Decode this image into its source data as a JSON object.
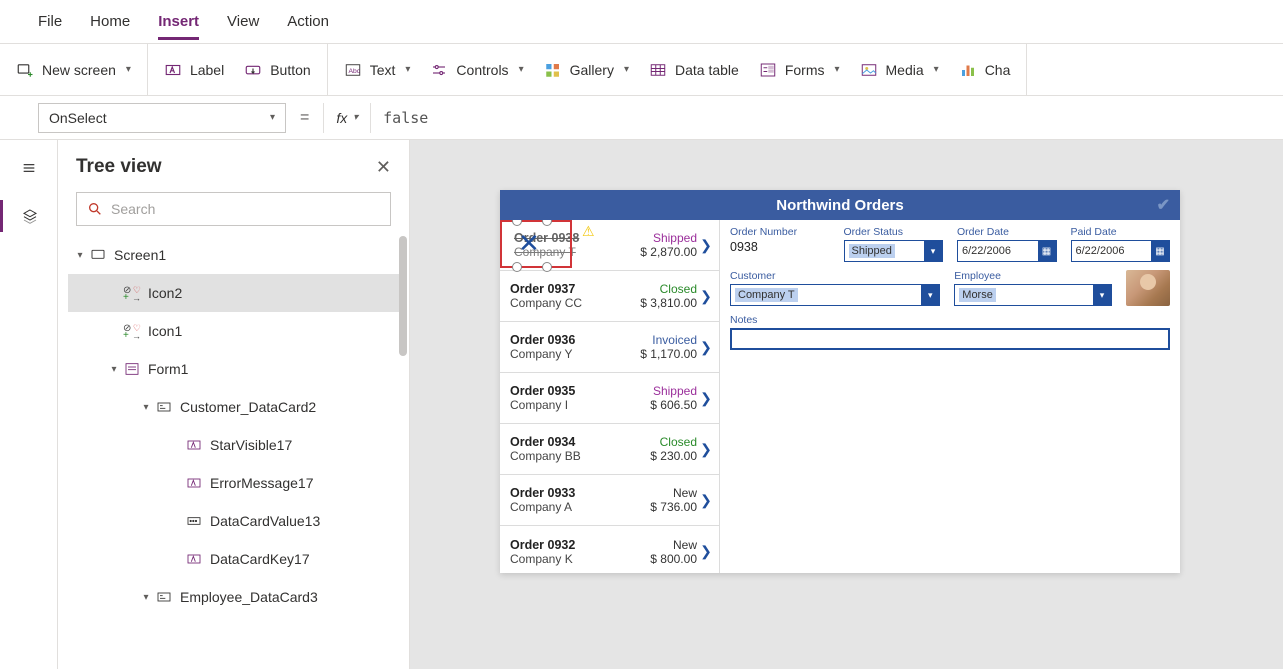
{
  "menubar": [
    "File",
    "Home",
    "Insert",
    "View",
    "Action"
  ],
  "menubar_active": 2,
  "ribbon": {
    "new_screen": "New screen",
    "label": "Label",
    "button": "Button",
    "text": "Text",
    "controls": "Controls",
    "gallery": "Gallery",
    "datatable": "Data table",
    "forms": "Forms",
    "media": "Media",
    "cha": "Cha"
  },
  "formula": {
    "property": "OnSelect",
    "equals": "=",
    "fx": "fx",
    "value": "false"
  },
  "treepanel": {
    "title": "Tree view",
    "search_placeholder": "Search",
    "items": [
      {
        "label": "Screen1",
        "type": "screen",
        "indent": 0,
        "expanded": true
      },
      {
        "label": "Icon2",
        "type": "icon-combo",
        "indent": 1,
        "selected": true
      },
      {
        "label": "Icon1",
        "type": "icon-combo",
        "indent": 1
      },
      {
        "label": "Form1",
        "type": "form",
        "indent": 1,
        "expanded": true
      },
      {
        "label": "Customer_DataCard2",
        "type": "card",
        "indent": 2,
        "expanded": true
      },
      {
        "label": "StarVisible17",
        "type": "label",
        "indent": 3
      },
      {
        "label": "ErrorMessage17",
        "type": "label",
        "indent": 3
      },
      {
        "label": "DataCardValue13",
        "type": "combo",
        "indent": 3
      },
      {
        "label": "DataCardKey17",
        "type": "label",
        "indent": 3
      },
      {
        "label": "Employee_DataCard3",
        "type": "card",
        "indent": 2,
        "expanded": true
      }
    ]
  },
  "app": {
    "title": "Northwind Orders",
    "orders": [
      {
        "num": "Order 0938",
        "company": "Company T",
        "status": "Shipped",
        "price": "$ 2,870.00"
      },
      {
        "num": "Order 0937",
        "company": "Company CC",
        "status": "Closed",
        "price": "$ 3,810.00"
      },
      {
        "num": "Order 0936",
        "company": "Company Y",
        "status": "Invoiced",
        "price": "$ 1,170.00"
      },
      {
        "num": "Order 0935",
        "company": "Company I",
        "status": "Shipped",
        "price": "$ 606.50"
      },
      {
        "num": "Order 0934",
        "company": "Company BB",
        "status": "Closed",
        "price": "$ 230.00"
      },
      {
        "num": "Order 0933",
        "company": "Company A",
        "status": "New",
        "price": "$ 736.00"
      },
      {
        "num": "Order 0932",
        "company": "Company K",
        "status": "New",
        "price": "$ 800.00"
      }
    ],
    "detail": {
      "ordernum_label": "Order Number",
      "ordernum": "0938",
      "orderstatus_label": "Order Status",
      "orderstatus": "Shipped",
      "orderdate_label": "Order Date",
      "orderdate": "6/22/2006",
      "paiddate_label": "Paid Date",
      "paiddate": "6/22/2006",
      "customer_label": "Customer",
      "customer": "Company T",
      "employee_label": "Employee",
      "employee": "Morse",
      "notes_label": "Notes"
    }
  }
}
